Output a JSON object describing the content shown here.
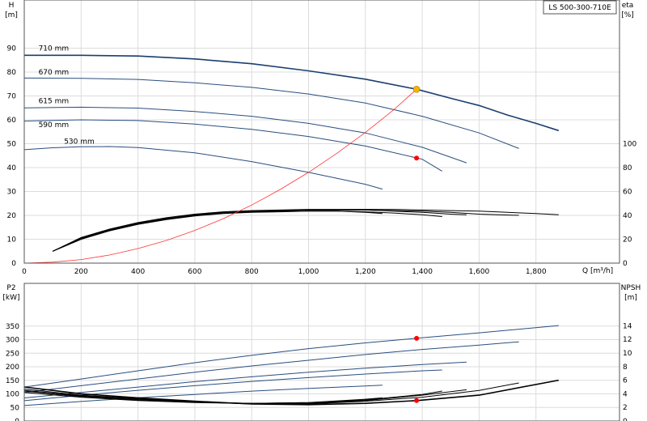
{
  "model_label": "LS 500-300-710E",
  "top_chart": {
    "y_left_title": "H",
    "y_left_unit": "[m]",
    "y_right_title": "eta",
    "y_right_unit": "[%]",
    "x_unit": "Q [m³/h]",
    "x_ticks": [
      "0",
      "200",
      "400",
      "600",
      "800",
      "1,000",
      "1,200",
      "1,400",
      "1,600",
      "1,800"
    ],
    "y_left_ticks": [
      "0",
      "10",
      "20",
      "30",
      "40",
      "50",
      "60",
      "70",
      "80",
      "90"
    ],
    "y_right_ticks": [
      "0",
      "20",
      "40",
      "60",
      "80",
      "100"
    ]
  },
  "bottom_chart": {
    "y_left_title": "P2",
    "y_left_unit": "[kW]",
    "y_right_title": "NPSH",
    "y_right_unit": "[m]",
    "y_left_ticks": [
      "0",
      "50",
      "100",
      "150",
      "200",
      "250",
      "300",
      "350"
    ],
    "y_right_ticks": [
      "0",
      "2",
      "4",
      "6",
      "8",
      "10",
      "12",
      "14"
    ]
  },
  "colors": {
    "head_curve": "#2a4e7f",
    "head_curve_highlight": "#1b3e6e",
    "eta_curve": "#000000",
    "system_curve": "#ff3333",
    "duty_point_head": "#f5b400",
    "duty_point": "#ff0000",
    "grid": "#dcdcdc"
  },
  "chart_data": [
    {
      "type": "line",
      "name": "head_curves",
      "xlabel": "Q [m³/h]",
      "ylabel": "H [m]",
      "xlim": [
        0,
        1880
      ],
      "ylim": [
        0,
        100
      ],
      "series": [
        {
          "name": "710 mm",
          "label_at": [
            50,
            89
          ],
          "points": [
            [
              0,
              87
            ],
            [
              200,
              87
            ],
            [
              400,
              86.7
            ],
            [
              600,
              85.5
            ],
            [
              800,
              83.5
            ],
            [
              1000,
              80.5
            ],
            [
              1200,
              77
            ],
            [
              1380,
              72.8
            ],
            [
              1500,
              69
            ],
            [
              1600,
              66
            ],
            [
              1700,
              62
            ],
            [
              1800,
              58.5
            ],
            [
              1880,
              55.5
            ]
          ]
        },
        {
          "name": "670 mm",
          "label_at": [
            50,
            79
          ],
          "points": [
            [
              0,
              77.5
            ],
            [
              200,
              77.4
            ],
            [
              400,
              76.9
            ],
            [
              600,
              75.5
            ],
            [
              800,
              73.6
            ],
            [
              1000,
              70.8
            ],
            [
              1200,
              67
            ],
            [
              1400,
              61.5
            ],
            [
              1600,
              54.5
            ],
            [
              1740,
              48
            ]
          ]
        },
        {
          "name": "615 mm",
          "label_at": [
            50,
            67
          ],
          "points": [
            [
              0,
              65
            ],
            [
              200,
              65.3
            ],
            [
              400,
              64.9
            ],
            [
              600,
              63.5
            ],
            [
              800,
              61.5
            ],
            [
              1000,
              58.5
            ],
            [
              1200,
              54.5
            ],
            [
              1400,
              48.5
            ],
            [
              1556,
              42
            ]
          ]
        },
        {
          "name": "590 mm",
          "label_at": [
            50,
            57
          ],
          "points": [
            [
              0,
              59.5
            ],
            [
              200,
              60
            ],
            [
              400,
              59.7
            ],
            [
              600,
              58.2
            ],
            [
              800,
              56
            ],
            [
              1000,
              53
            ],
            [
              1200,
              49
            ],
            [
              1400,
              43.5
            ],
            [
              1470,
              38.5
            ]
          ]
        },
        {
          "name": "530 mm",
          "label_at": [
            140,
            50
          ],
          "points": [
            [
              0,
              47.5
            ],
            [
              100,
              48.3
            ],
            [
              200,
              48.7
            ],
            [
              300,
              48.8
            ],
            [
              400,
              48.4
            ],
            [
              600,
              46.2
            ],
            [
              800,
              42.5
            ],
            [
              1000,
              38
            ],
            [
              1200,
              33
            ],
            [
              1260,
              31
            ]
          ]
        }
      ],
      "system_curve": {
        "points": [
          [
            0,
            0
          ],
          [
            100,
            0.4
          ],
          [
            200,
            1.5
          ],
          [
            300,
            3.4
          ],
          [
            400,
            6.1
          ],
          [
            500,
            9.5
          ],
          [
            600,
            13.7
          ],
          [
            700,
            18.6
          ],
          [
            800,
            24.3
          ],
          [
            900,
            30.8
          ],
          [
            1000,
            38
          ],
          [
            1100,
            46
          ],
          [
            1200,
            54.7
          ],
          [
            1300,
            64.2
          ],
          [
            1380,
            72.8
          ]
        ]
      },
      "duty_point": {
        "q": 1380,
        "h": 72.8
      },
      "eta_curves": [
        {
          "points": [
            [
              100,
              10
            ],
            [
              200,
              20
            ],
            [
              300,
              27.5
            ],
            [
              400,
              33
            ],
            [
              500,
              37
            ],
            [
              600,
              40
            ],
            [
              700,
              42
            ],
            [
              800,
              43.5
            ],
            [
              900,
              44
            ],
            [
              1000,
              44.5
            ],
            [
              1100,
              44.5
            ],
            [
              1200,
              44.5
            ],
            [
              1300,
              43.5
            ],
            [
              1400,
              42.5
            ],
            [
              1500,
              41
            ],
            [
              1556,
              40.5
            ]
          ]
        },
        {
          "points": [
            [
              100,
              10
            ],
            [
              200,
              21
            ],
            [
              300,
              28
            ],
            [
              400,
              33.5
            ],
            [
              500,
              37.5
            ],
            [
              600,
              40.5
            ],
            [
              700,
              42.5
            ],
            [
              800,
              43.5
            ],
            [
              900,
              44
            ],
            [
              1000,
              44.5
            ],
            [
              1100,
              44.5
            ],
            [
              1200,
              44.5
            ],
            [
              1300,
              44
            ],
            [
              1400,
              43.5
            ],
            [
              1500,
              42.5
            ],
            [
              1600,
              41
            ],
            [
              1740,
              40
            ]
          ]
        },
        {
          "points": [
            [
              100,
              10
            ],
            [
              200,
              21.5
            ],
            [
              300,
              28.5
            ],
            [
              400,
              34
            ],
            [
              500,
              38
            ],
            [
              600,
              41
            ],
            [
              700,
              43
            ],
            [
              800,
              44
            ],
            [
              900,
              44.5
            ],
            [
              1000,
              45
            ],
            [
              1100,
              45
            ],
            [
              1200,
              45
            ],
            [
              1300,
              45
            ],
            [
              1400,
              44.5
            ],
            [
              1500,
              44
            ],
            [
              1600,
              43.5
            ],
            [
              1700,
              42.5
            ],
            [
              1800,
              41.5
            ],
            [
              1880,
              40.5
            ]
          ]
        },
        {
          "points": [
            [
              100,
              10
            ],
            [
              200,
              20
            ],
            [
              300,
              27
            ],
            [
              400,
              32.5
            ],
            [
              500,
              36.5
            ],
            [
              600,
              39.5
            ],
            [
              700,
              41.5
            ],
            [
              800,
              42.5
            ],
            [
              900,
              43
            ],
            [
              1000,
              43.5
            ],
            [
              1100,
              43.5
            ],
            [
              1200,
              43
            ],
            [
              1300,
              42
            ],
            [
              1400,
              40.5
            ],
            [
              1470,
              39
            ]
          ]
        },
        {
          "points": [
            [
              100,
              10
            ],
            [
              200,
              20.5
            ],
            [
              300,
              27.5
            ],
            [
              400,
              33
            ],
            [
              500,
              37
            ],
            [
              600,
              40
            ],
            [
              700,
              42
            ],
            [
              800,
              43
            ],
            [
              900,
              43.5
            ],
            [
              1000,
              43.5
            ],
            [
              1100,
              43.5
            ],
            [
              1200,
              42.5
            ],
            [
              1260,
              41.5
            ]
          ]
        }
      ],
      "eta_duty_point": {
        "q": 1380,
        "eta": 88
      }
    },
    {
      "type": "line",
      "name": "power_curves",
      "ylabel": "P2 [kW]",
      "xlim": [
        0,
        1880
      ],
      "ylim": [
        0,
        360
      ],
      "series": [
        {
          "name": "710 mm",
          "points": [
            [
              0,
              125
            ],
            [
              200,
              155
            ],
            [
              400,
              185
            ],
            [
              600,
              215
            ],
            [
              800,
              242
            ],
            [
              1000,
              267
            ],
            [
              1200,
              288
            ],
            [
              1380,
              305
            ],
            [
              1600,
              325
            ],
            [
              1880,
              352
            ]
          ]
        },
        {
          "name": "670 mm",
          "points": [
            [
              0,
              105
            ],
            [
              200,
              130
            ],
            [
              400,
              155
            ],
            [
              600,
              180
            ],
            [
              800,
              203
            ],
            [
              1000,
              224
            ],
            [
              1200,
              245
            ],
            [
              1400,
              264
            ],
            [
              1600,
              280
            ],
            [
              1740,
              292
            ]
          ]
        },
        {
          "name": "615 mm",
          "points": [
            [
              0,
              85
            ],
            [
              200,
              105
            ],
            [
              400,
              125
            ],
            [
              600,
              145
            ],
            [
              800,
              163
            ],
            [
              1000,
              180
            ],
            [
              1200,
              195
            ],
            [
              1400,
              208
            ],
            [
              1556,
              217
            ]
          ]
        },
        {
          "name": "590 mm",
          "points": [
            [
              0,
              75
            ],
            [
              200,
              95
            ],
            [
              400,
              113
            ],
            [
              600,
              130
            ],
            [
              800,
              146
            ],
            [
              1000,
              160
            ],
            [
              1200,
              173
            ],
            [
              1400,
              185
            ],
            [
              1470,
              188
            ]
          ]
        },
        {
          "name": "530 mm",
          "points": [
            [
              0,
              57
            ],
            [
              200,
              72
            ],
            [
              400,
              86
            ],
            [
              600,
              98
            ],
            [
              800,
              110
            ],
            [
              1000,
              120
            ],
            [
              1200,
              129
            ],
            [
              1260,
              132
            ]
          ]
        }
      ],
      "duty_point": {
        "q": 1380,
        "p2": 305
      }
    },
    {
      "type": "line",
      "name": "npsh_curves",
      "ylabel": "NPSH [m]",
      "xlim": [
        0,
        1880
      ],
      "ylim": [
        0,
        16
      ],
      "series": [
        {
          "points": [
            [
              0,
              5
            ],
            [
              200,
              4
            ],
            [
              400,
              3.4
            ],
            [
              600,
              2.9
            ],
            [
              800,
              2.5
            ],
            [
              1000,
              2.4
            ],
            [
              1200,
              2.6
            ],
            [
              1380,
              3.0
            ],
            [
              1600,
              3.8
            ],
            [
              1880,
              6.0
            ]
          ]
        },
        {
          "points": [
            [
              0,
              4.7
            ],
            [
              200,
              3.8
            ],
            [
              400,
              3.3
            ],
            [
              600,
              2.8
            ],
            [
              800,
              2.5
            ],
            [
              1000,
              2.5
            ],
            [
              1200,
              2.9
            ],
            [
              1400,
              3.5
            ],
            [
              1600,
              4.5
            ],
            [
              1740,
              5.6
            ]
          ]
        },
        {
          "points": [
            [
              0,
              4.5
            ],
            [
              200,
              3.7
            ],
            [
              400,
              3.2
            ],
            [
              600,
              2.8
            ],
            [
              800,
              2.6
            ],
            [
              1000,
              2.6
            ],
            [
              1200,
              3.0
            ],
            [
              1400,
              3.8
            ],
            [
              1556,
              4.6
            ]
          ]
        },
        {
          "points": [
            [
              0,
              4.4
            ],
            [
              200,
              3.6
            ],
            [
              400,
              3.1
            ],
            [
              600,
              2.8
            ],
            [
              800,
              2.6
            ],
            [
              1000,
              2.7
            ],
            [
              1200,
              3.1
            ],
            [
              1400,
              3.9
            ],
            [
              1470,
              4.4
            ]
          ]
        },
        {
          "points": [
            [
              0,
              4.2
            ],
            [
              200,
              3.5
            ],
            [
              400,
              3.0
            ],
            [
              600,
              2.7
            ],
            [
              800,
              2.6
            ],
            [
              1000,
              2.7
            ],
            [
              1200,
              3.2
            ],
            [
              1260,
              3.4
            ]
          ]
        }
      ],
      "duty_point": {
        "q": 1380,
        "npsh": 3.0
      }
    }
  ]
}
